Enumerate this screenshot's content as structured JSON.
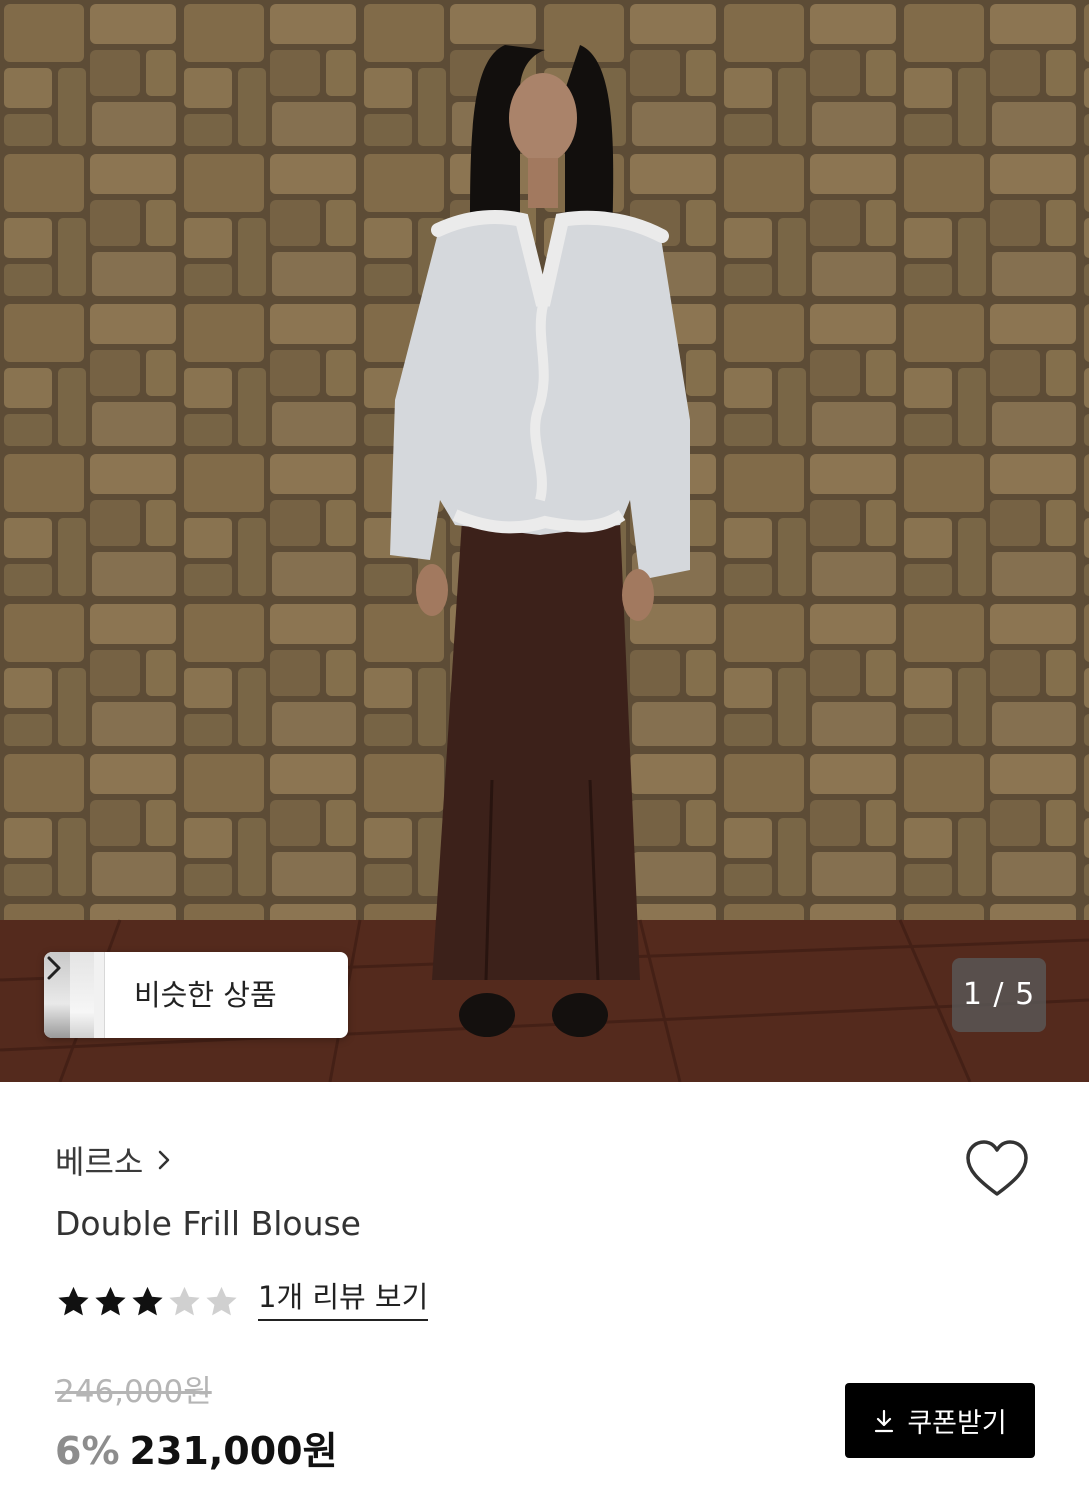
{
  "hero": {
    "image_alt": "model-in-white-blouse",
    "similar_button": {
      "label": "비슷한 상품"
    },
    "page_counter": "1 / 5"
  },
  "product": {
    "brand": "베르소",
    "title": "Double Frill Blouse",
    "rating": 3,
    "rating_max": 5,
    "review_link": "1개 리뷰 보기",
    "original_price": "246,000원",
    "discount": "6%",
    "final_price": "231,000원"
  },
  "actions": {
    "coupon_label": "쿠폰받기",
    "wishlist_icon": "heart-icon"
  },
  "colors": {
    "accent_black": "#000000",
    "star_filled": "#111111",
    "star_empty": "#d0d0d0",
    "strike_gray": "#b5b5b5"
  }
}
